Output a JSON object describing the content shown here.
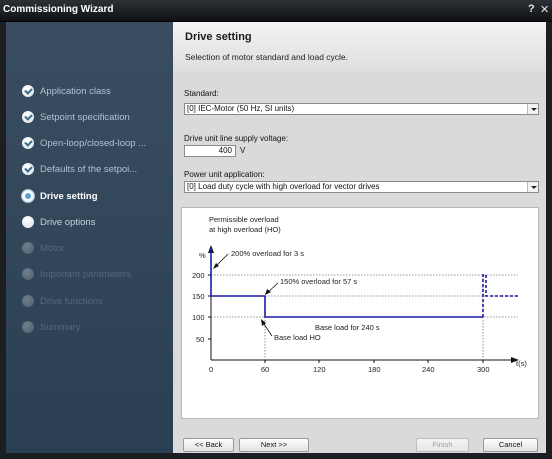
{
  "window": {
    "title": "Commissioning Wizard",
    "help_label": "?",
    "close_label": "✕"
  },
  "sidebar": {
    "items": [
      {
        "label": "Application class",
        "state": "done"
      },
      {
        "label": "Setpoint specification",
        "state": "done"
      },
      {
        "label": "Open-loop/closed-loop ...",
        "state": "done"
      },
      {
        "label": "Defaults of the setpoi...",
        "state": "done"
      },
      {
        "label": "Drive setting",
        "state": "active"
      },
      {
        "label": "Drive options",
        "state": "next"
      },
      {
        "label": "Motor",
        "state": "disabled"
      },
      {
        "label": "Important parameters",
        "state": "disabled"
      },
      {
        "label": "Drive functions",
        "state": "disabled"
      },
      {
        "label": "Summary",
        "state": "disabled"
      }
    ]
  },
  "header": {
    "title": "Drive setting",
    "subtitle": "Selection of motor standard and load cycle."
  },
  "form": {
    "standard_label": "Standard:",
    "standard_value": "[0] IEC-Motor (50 Hz, SI units)",
    "voltage_label": "Drive unit line supply voltage:",
    "voltage_value": "400",
    "voltage_unit": "V",
    "power_label": "Power unit application:",
    "power_value": "[0] Load duty cycle with high overload for vector drives"
  },
  "diagram": {
    "title_line1": "Permissible overload",
    "title_line2": "at high overload (HO)",
    "y_unit": "%",
    "x_unit": "t(s)",
    "y_ticks": [
      "200",
      "150",
      "100",
      "50"
    ],
    "x_ticks": [
      "0",
      "60",
      "120",
      "180",
      "240",
      "300"
    ],
    "ann_200": "200% overload for 3 s",
    "ann_150": "150% overload for 57 s",
    "ann_base_240": "Base load for 240 s",
    "ann_base_ho": "Base load HO",
    "line_color": "#1a1aa8"
  },
  "buttons": {
    "back": "<< Back",
    "next": "Next >>",
    "finish": "Finish",
    "cancel": "Cancel"
  }
}
